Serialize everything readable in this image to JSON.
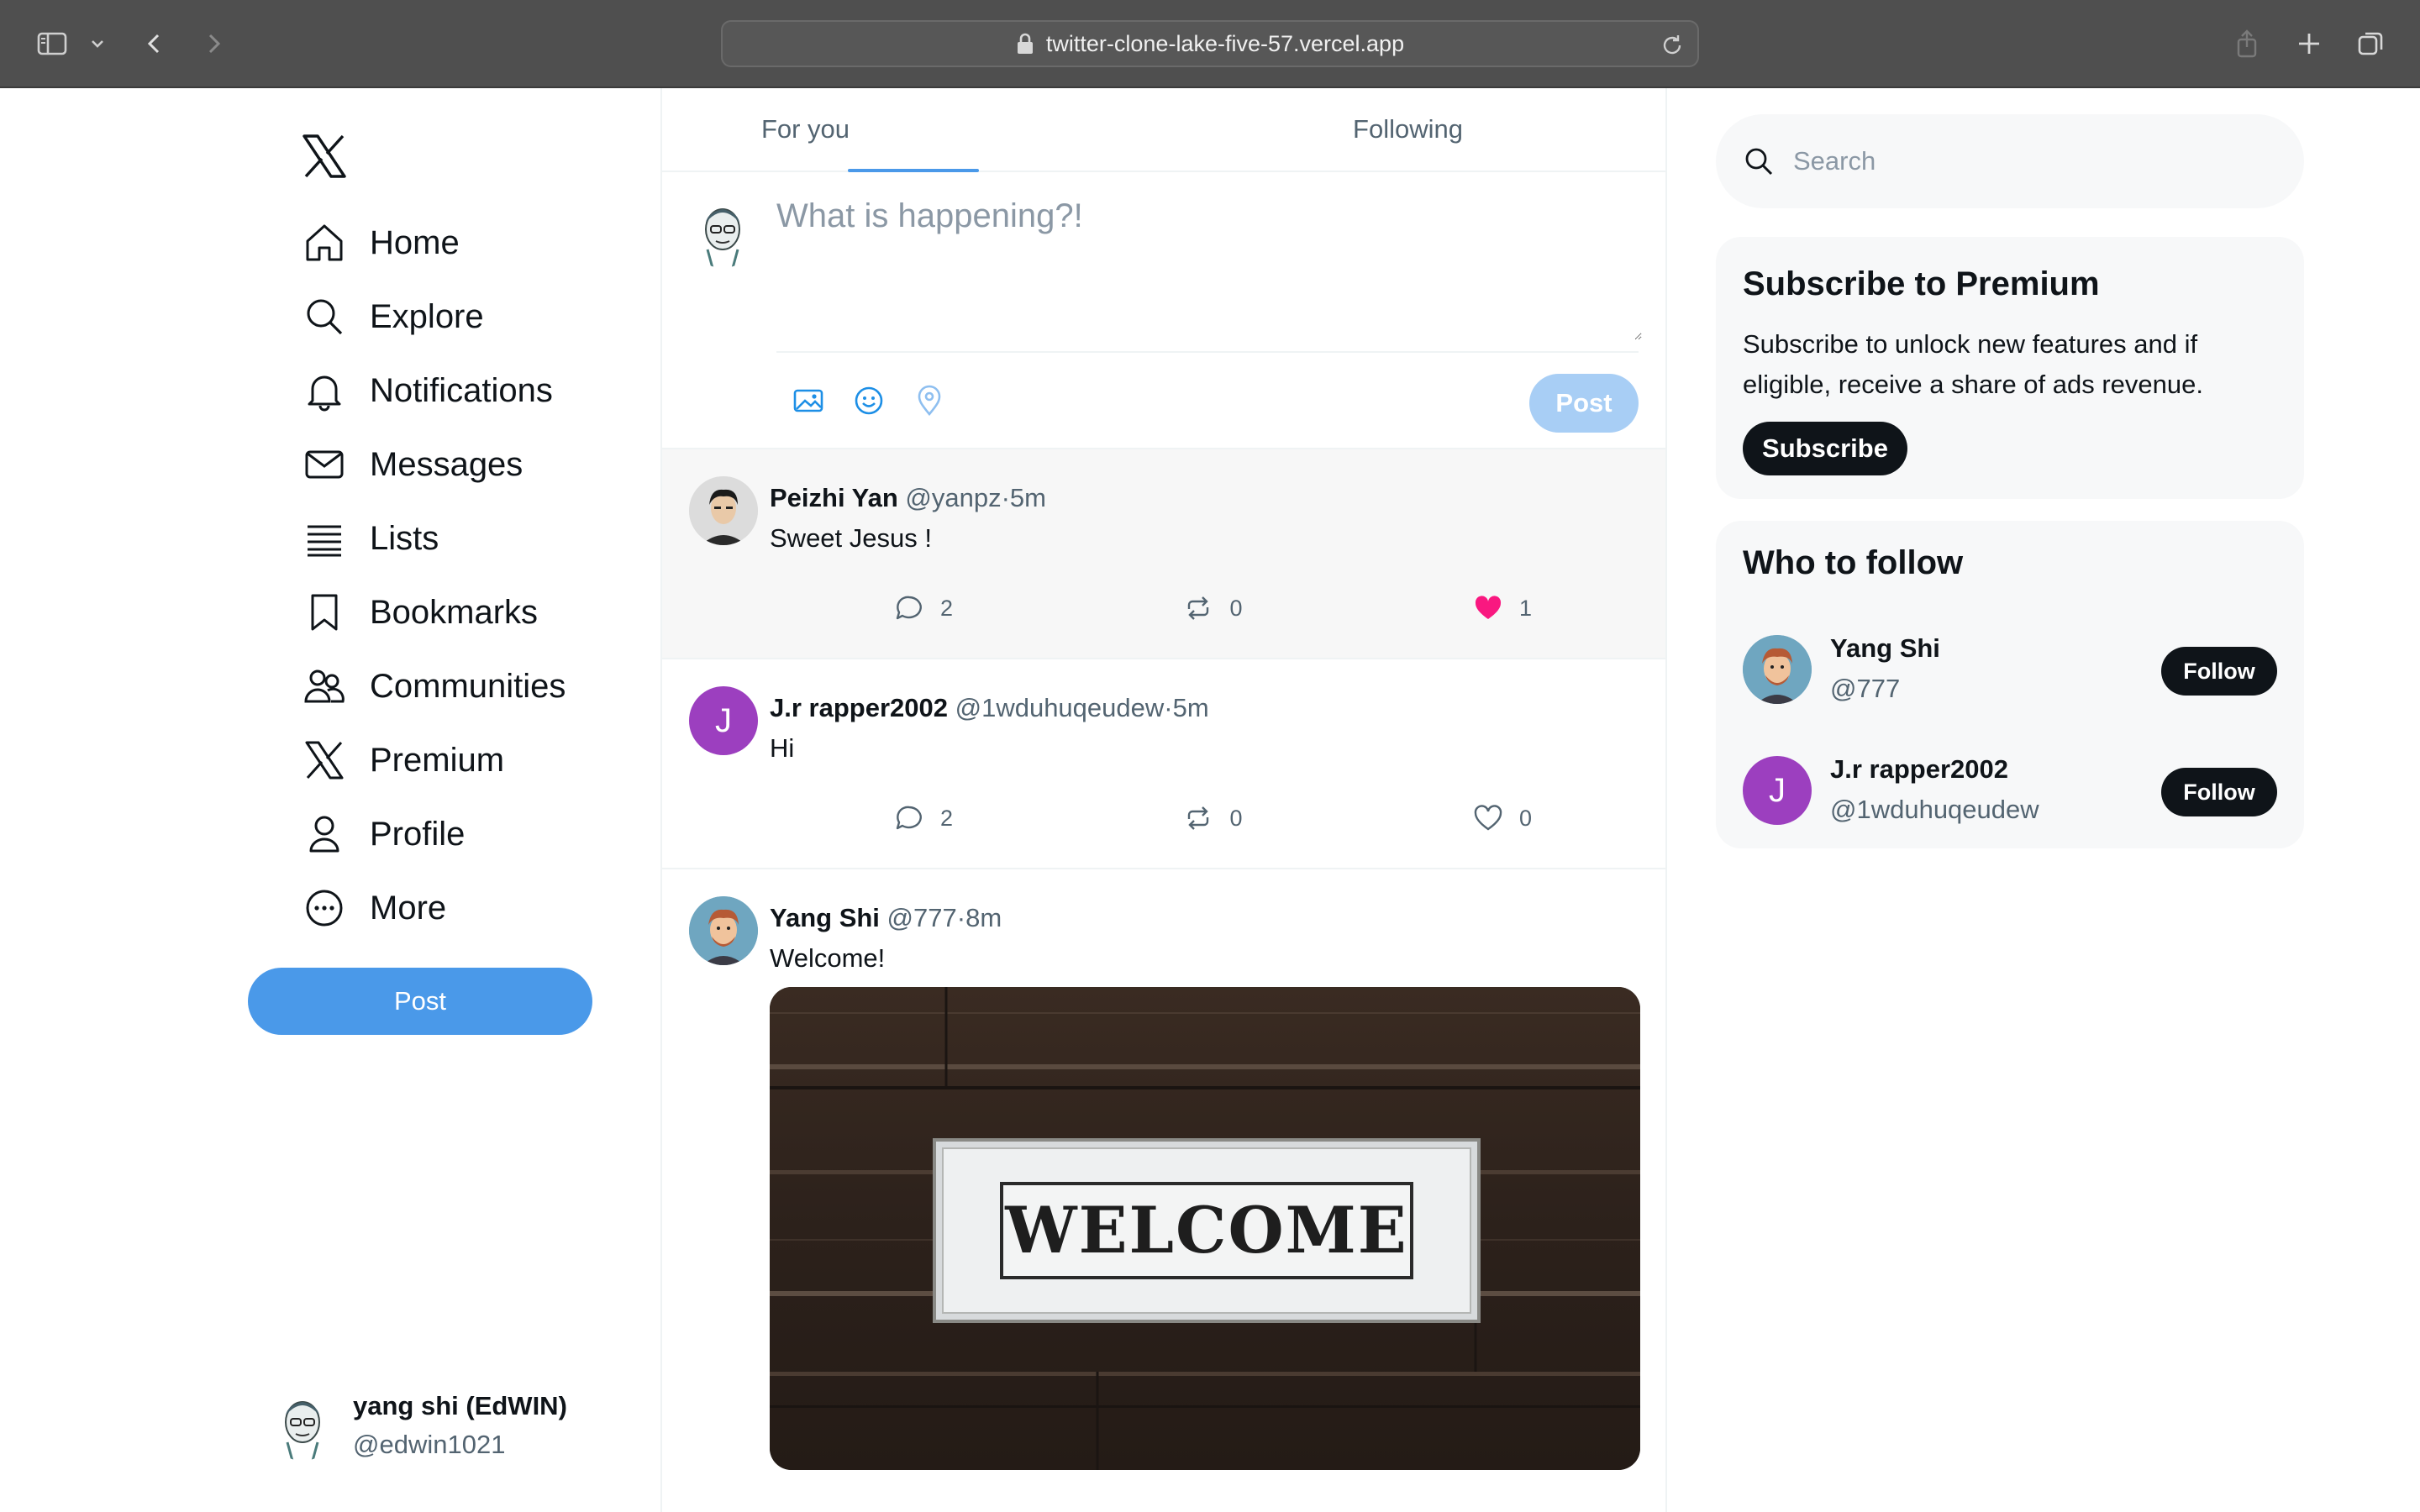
{
  "browser": {
    "url": "twitter-clone-lake-five-57.vercel.app"
  },
  "sidebar": {
    "items": [
      {
        "label": "Home",
        "icon": "home-icon"
      },
      {
        "label": "Explore",
        "icon": "search-icon"
      },
      {
        "label": "Notifications",
        "icon": "bell-icon"
      },
      {
        "label": "Messages",
        "icon": "mail-icon"
      },
      {
        "label": "Lists",
        "icon": "list-icon"
      },
      {
        "label": "Bookmarks",
        "icon": "bookmark-icon"
      },
      {
        "label": "Communities",
        "icon": "people-icon"
      },
      {
        "label": "Premium",
        "icon": "x-logo-icon"
      },
      {
        "label": "Profile",
        "icon": "person-icon"
      },
      {
        "label": "More",
        "icon": "more-circle-icon"
      }
    ],
    "post_label": "Post",
    "user": {
      "name": "yang shi (EdWIN)",
      "handle": "@edwin1021"
    }
  },
  "feed": {
    "tabs": [
      {
        "label": "For you",
        "active": true
      },
      {
        "label": "Following",
        "active": false
      }
    ],
    "compose": {
      "placeholder": "What is happening?!",
      "post_label": "Post"
    },
    "tweets": [
      {
        "name": "Peizhi Yan",
        "handle": "@yanpz",
        "time": "·5m",
        "text": "Sweet Jesus !",
        "replies": "2",
        "retweets": "0",
        "likes": "1",
        "liked": true
      },
      {
        "name": "J.r rapper2002",
        "handle": "@1wduhuqeudew",
        "time": "·5m",
        "text": "Hi",
        "replies": "2",
        "retweets": "0",
        "likes": "0",
        "liked": false,
        "avatar_letter": "J"
      },
      {
        "name": "Yang Shi",
        "handle": "@777",
        "time": "·8m",
        "text": "Welcome!",
        "image_sign": "WELCOME"
      }
    ]
  },
  "right": {
    "search_placeholder": "Search",
    "premium": {
      "title": "Subscribe to Premium",
      "body": "Subscribe to unlock new features and if eligible, receive a share of ads revenue.",
      "button": "Subscribe"
    },
    "who_to_follow": {
      "title": "Who to follow",
      "users": [
        {
          "name": "Yang Shi",
          "handle": "@777",
          "button": "Follow"
        },
        {
          "name": "J.r rapper2002",
          "handle": "@1wduhuqeudew",
          "button": "Follow",
          "avatar_letter": "J"
        }
      ]
    }
  },
  "colors": {
    "accent": "#4a99e9",
    "like": "#f91880",
    "letter_avatar": "#9c3fbf"
  }
}
